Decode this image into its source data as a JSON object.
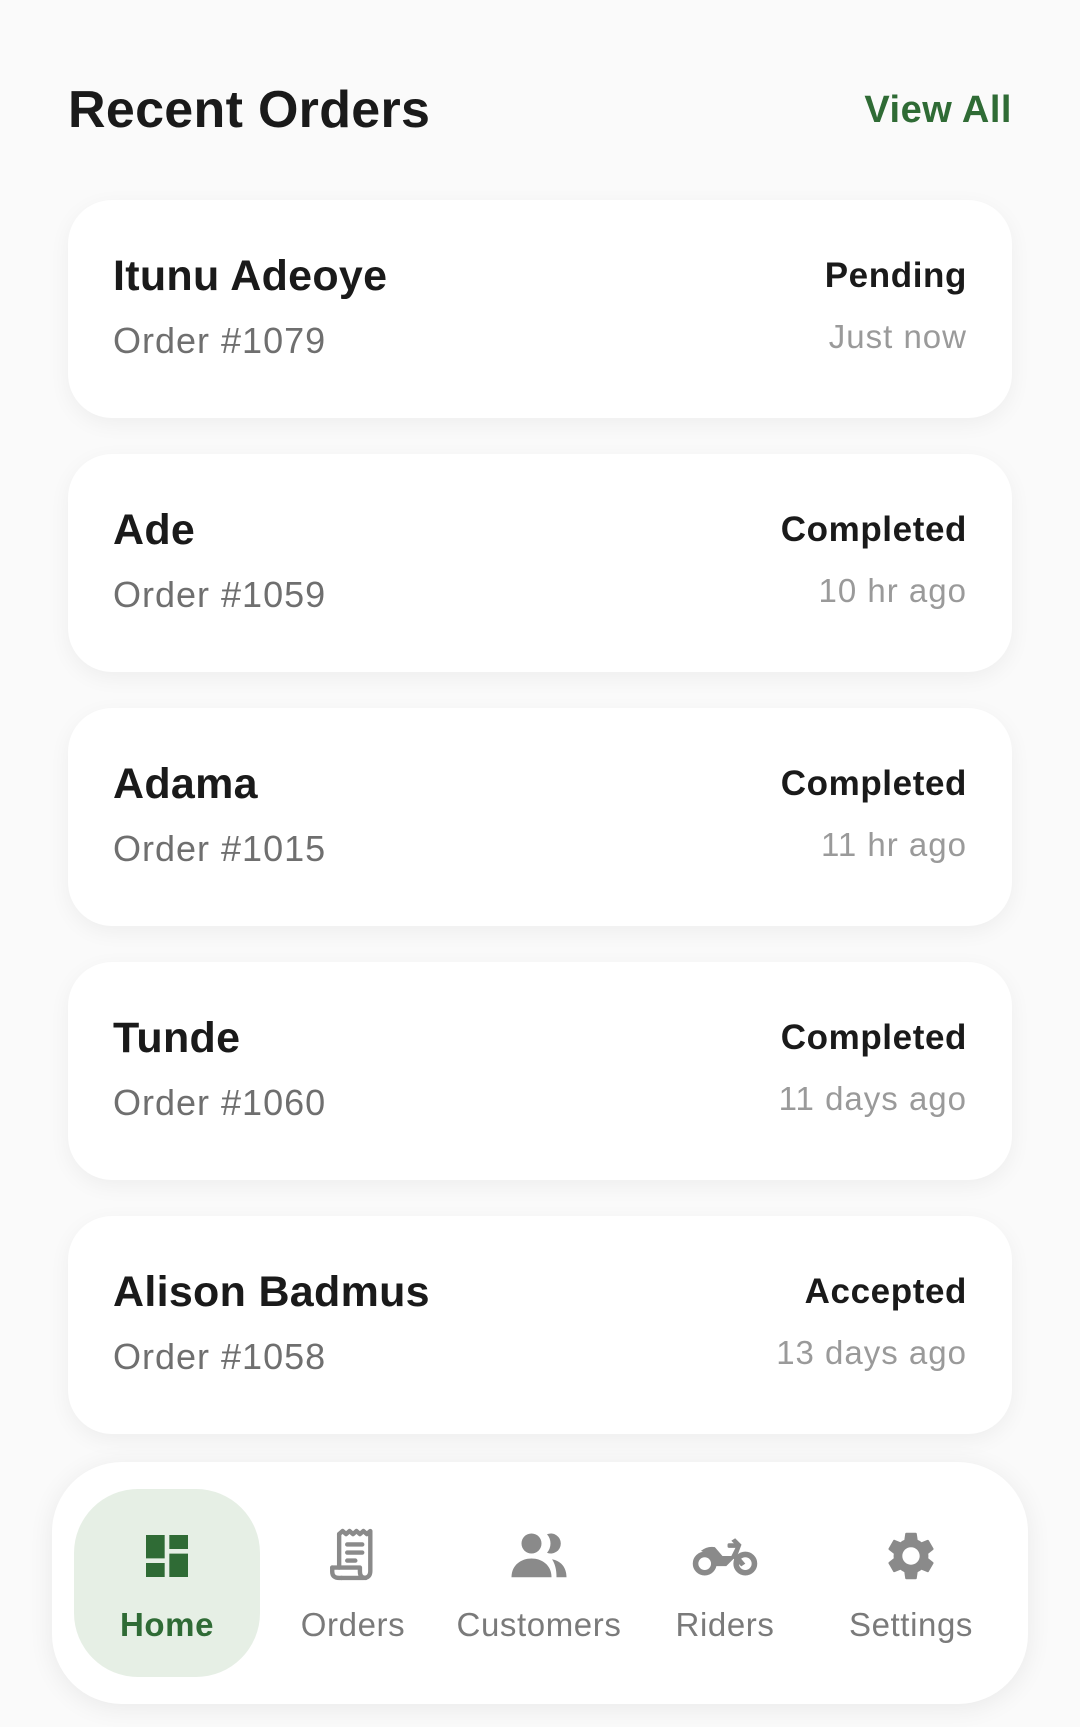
{
  "header": {
    "title": "Recent Orders",
    "view_all": "View All"
  },
  "orders": [
    {
      "customer": "Itunu Adeoye",
      "order_number": "Order #1079",
      "status": "Pending",
      "time": "Just now"
    },
    {
      "customer": "Ade",
      "order_number": "Order #1059",
      "status": "Completed",
      "time": "10 hr ago"
    },
    {
      "customer": "Adama",
      "order_number": "Order #1015",
      "status": "Completed",
      "time": "11 hr ago"
    },
    {
      "customer": "Tunde",
      "order_number": "Order #1060",
      "status": "Completed",
      "time": "11 days ago"
    },
    {
      "customer": "Alison Badmus",
      "order_number": "Order #1058",
      "status": "Accepted",
      "time": "13 days ago"
    }
  ],
  "nav": {
    "items": [
      {
        "label": "Home",
        "icon": "dashboard-icon",
        "active": true
      },
      {
        "label": "Orders",
        "icon": "receipt-icon",
        "active": false
      },
      {
        "label": "Customers",
        "icon": "people-icon",
        "active": false
      },
      {
        "label": "Riders",
        "icon": "motorcycle-icon",
        "active": false
      },
      {
        "label": "Settings",
        "icon": "gear-icon",
        "active": false
      }
    ]
  },
  "colors": {
    "accent": "#2f6b35",
    "accent_bg": "#e6efe5",
    "inactive_icon": "#8a8a8a",
    "background": "#fafafa"
  }
}
